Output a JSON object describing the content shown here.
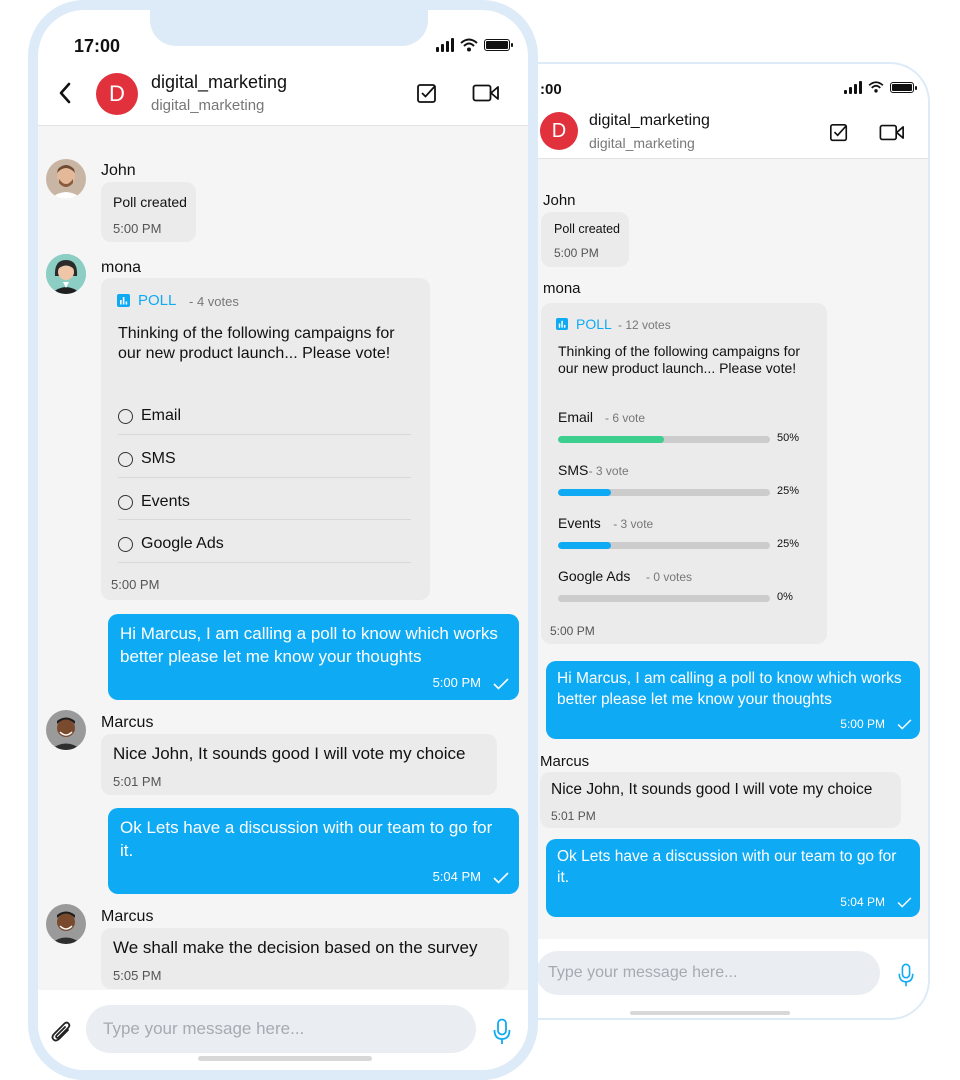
{
  "colors": {
    "accent": "#0eaaf4",
    "avatar": "#e0313c",
    "bar_green": "#3ccf8e",
    "bar_blue": "#0eaaf4",
    "bar_bg": "#cccccc"
  },
  "phone_a": {
    "status_time": "17:00",
    "header": {
      "avatar_letter": "D",
      "title": "digital_marketing",
      "subtitle": "digital_marketing"
    },
    "messages": {
      "john": {
        "sender": "John",
        "text": "Poll created",
        "time": "5:00 PM"
      },
      "mona": {
        "sender": "mona",
        "poll_label": "POLL",
        "poll_votes": "- 4 votes",
        "question": "Thinking of the following campaigns for our new product launch... Please vote!",
        "options": [
          "Email",
          "SMS",
          "Events",
          "Google Ads"
        ],
        "time": "5:00 PM"
      },
      "out1": {
        "text": "Hi Marcus, I am calling a poll to know which works better please let me know your thoughts",
        "time": "5:00 PM"
      },
      "marcus1": {
        "sender": "Marcus",
        "text": "Nice John, It sounds good I will vote my choice",
        "time": "5:01 PM"
      },
      "out2": {
        "text": "Ok Lets have a discussion with our team to go for it.",
        "time": "5:04 PM"
      },
      "marcus2": {
        "sender": "Marcus",
        "text": "We shall make the decision based on the survey",
        "time": "5:05 PM"
      }
    },
    "composer": {
      "placeholder": "Type your message here..."
    }
  },
  "phone_b": {
    "status_time": ":00",
    "header": {
      "avatar_letter": "D",
      "title": "digital_marketing",
      "subtitle": "digital_marketing"
    },
    "messages": {
      "john": {
        "sender": "John",
        "text": "Poll created",
        "time": "5:00 PM"
      },
      "mona": {
        "sender": "mona",
        "poll_label": "POLL",
        "poll_votes": "- 12 votes",
        "question": "Thinking of the following campaigns for our new product launch... Please vote!",
        "results": [
          {
            "label": "Email",
            "votes": "- 6 vote",
            "percent": 50,
            "percent_text": "50%",
            "color": "#3ccf8e"
          },
          {
            "label": "SMS",
            "votes": "- 3 vote",
            "percent": 25,
            "percent_text": "25%",
            "color": "#0eaaf4"
          },
          {
            "label": "Events",
            "votes": "- 3 vote",
            "percent": 25,
            "percent_text": "25%",
            "color": "#0eaaf4"
          },
          {
            "label": "Google Ads",
            "votes": "- 0 votes",
            "percent": 0,
            "percent_text": "0%",
            "color": "#0eaaf4"
          }
        ],
        "time": "5:00 PM"
      },
      "out1": {
        "text": "Hi Marcus, I am calling a poll to know which works better please let me know your thoughts",
        "time": "5:00 PM"
      },
      "marcus1": {
        "sender": "Marcus",
        "text": "Nice John, It sounds good I will vote my choice",
        "time": "5:01 PM"
      },
      "out2": {
        "text": "Ok Lets have a discussion with our team to go for it.",
        "time": "5:04 PM"
      }
    },
    "composer": {
      "placeholder": "Type your message here..."
    }
  }
}
